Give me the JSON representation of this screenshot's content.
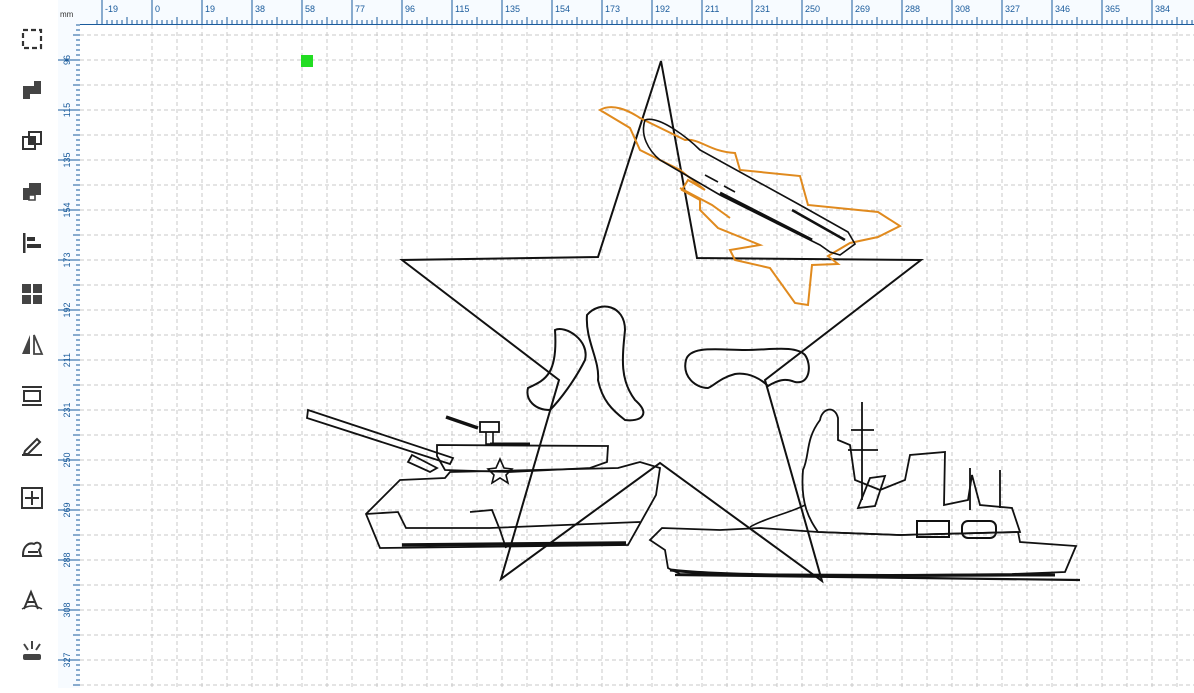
{
  "ruler": {
    "unit": "mm",
    "horizontal_labels": [
      "-19",
      "0",
      "19",
      "38",
      "58",
      "77",
      "96",
      "115",
      "135",
      "154",
      "173",
      "192",
      "211",
      "231",
      "250",
      "269",
      "288",
      "308",
      "327",
      "346",
      "365",
      "384"
    ],
    "vertical_labels": [
      "96",
      "115",
      "135",
      "154",
      "173",
      "192",
      "211",
      "231",
      "250",
      "269",
      "288",
      "308",
      "327"
    ]
  },
  "toolbar": {
    "tools": [
      {
        "icon": "shape-outline-icon"
      },
      {
        "icon": "union-icon"
      },
      {
        "icon": "intersect-icon"
      },
      {
        "icon": "subtract-icon"
      },
      {
        "icon": "align-left-icon"
      },
      {
        "icon": "grid-arrange-icon"
      },
      {
        "icon": "flip-icon"
      },
      {
        "icon": "distribute-icon"
      },
      {
        "icon": "edit-pen-icon"
      },
      {
        "icon": "array-icon"
      },
      {
        "icon": "weld-hand-icon"
      },
      {
        "icon": "text-path-icon"
      },
      {
        "icon": "explode-icon"
      }
    ]
  },
  "colors": {
    "ruler_text": "#1a5b9c",
    "selection_outline": "#e08a1e",
    "origin_marker": "#22dd22",
    "grid": "#c8c8c8"
  }
}
